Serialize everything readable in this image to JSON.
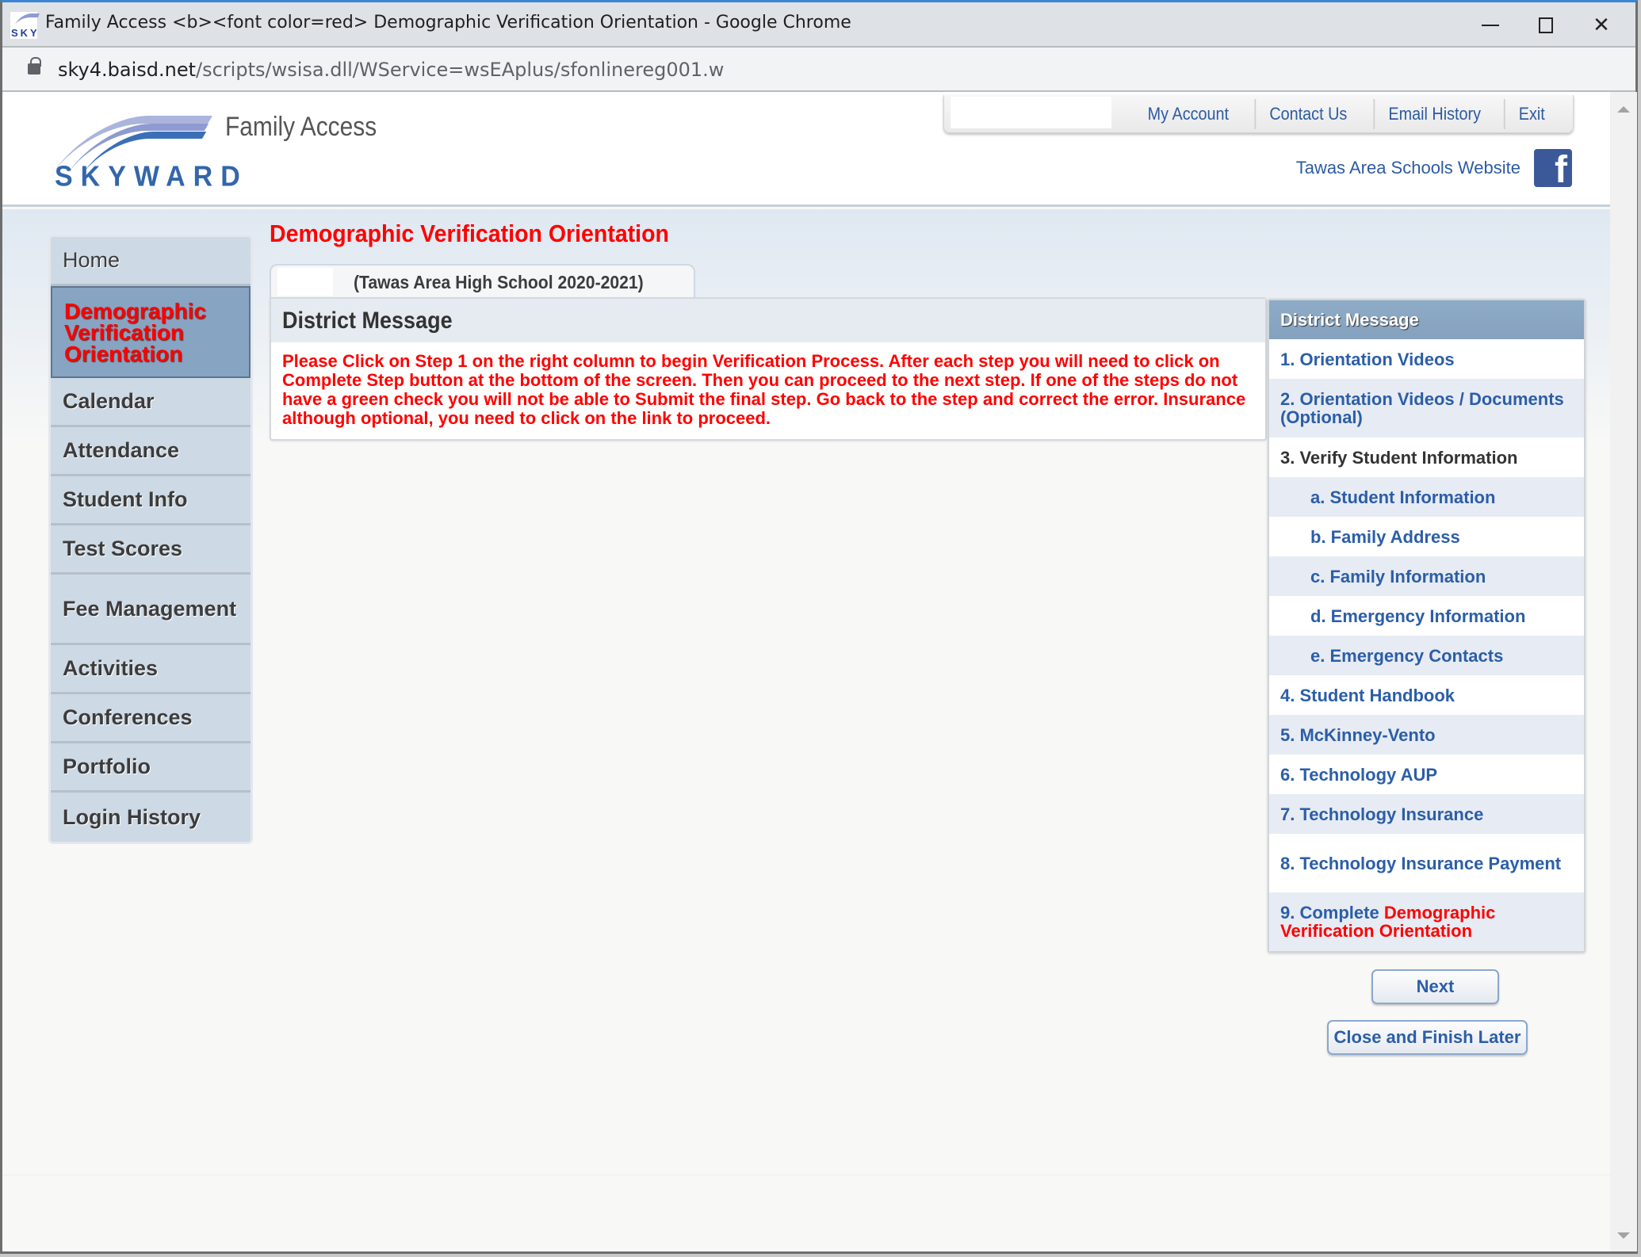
{
  "browser": {
    "window_title": "Family Access <b><font color=red> Demographic Verification Orientation - Google Chrome",
    "url_host": "sky4.baisd.net",
    "url_path": "/scripts/wsisa.dll/WService=wsEAplus/sfonlinereg001.w",
    "minimize_label": "—",
    "close_label": "✕"
  },
  "header": {
    "logo_text": "SKYWARD",
    "app_title": "Family Access",
    "nav_links": [
      "My Account",
      "Contact Us",
      "Email History",
      "Exit"
    ],
    "school_website_link": "Tawas Area Schools Website",
    "facebook_glyph": "f"
  },
  "sidebar": {
    "items": [
      {
        "label": "Home"
      },
      {
        "label": "Demographic Verification Orientation",
        "active": true
      },
      {
        "label": "Calendar"
      },
      {
        "label": "Attendance"
      },
      {
        "label": "Student Info"
      },
      {
        "label": "Test Scores"
      },
      {
        "label": "Fee Management"
      },
      {
        "label": "Activities"
      },
      {
        "label": "Conferences"
      },
      {
        "label": "Portfolio"
      },
      {
        "label": "Login History"
      }
    ]
  },
  "main": {
    "page_title": "Demographic Verification Orientation",
    "tab_label": "(Tawas Area High School 2020-2021)",
    "message_title": "District Message",
    "message_body": "Please Click on Step 1 on the right column to begin Verification Process. After each step you will need to click on Complete Step button at the bottom of the screen. Then you can proceed to the next step. If one of the steps do not have a green check you will not be able to Submit the final step. Go back to the step and correct the error. Insurance although optional, you need to click on the link to proceed."
  },
  "steps": {
    "header": "District Message",
    "items": [
      {
        "label": "1. Orientation Videos"
      },
      {
        "label": "2. Orientation Videos / Documents (Optional)"
      },
      {
        "label": "3. Verify Student Information"
      },
      {
        "label": "a. Student Information"
      },
      {
        "label": "b. Family Address"
      },
      {
        "label": "c. Family Information"
      },
      {
        "label": "d. Emergency Information"
      },
      {
        "label": "e. Emergency Contacts"
      },
      {
        "label": "4. Student Handbook"
      },
      {
        "label": "5. McKinney-Vento"
      },
      {
        "label": "6. Technology AUP"
      },
      {
        "label": "7. Technology Insurance"
      },
      {
        "label": "8. Technology Insurance Payment"
      },
      {
        "label_prefix": "9. Complete ",
        "label_highlight": "Demographic Verification Orientation"
      }
    ]
  },
  "buttons": {
    "next": "Next",
    "close_finish_later": "Close and Finish Later"
  },
  "colors": {
    "accent_red": "#ff0000",
    "link_blue": "#2b5ea8",
    "panel_header_blue": "#87a4c2",
    "facebook_blue": "#3b5998"
  }
}
